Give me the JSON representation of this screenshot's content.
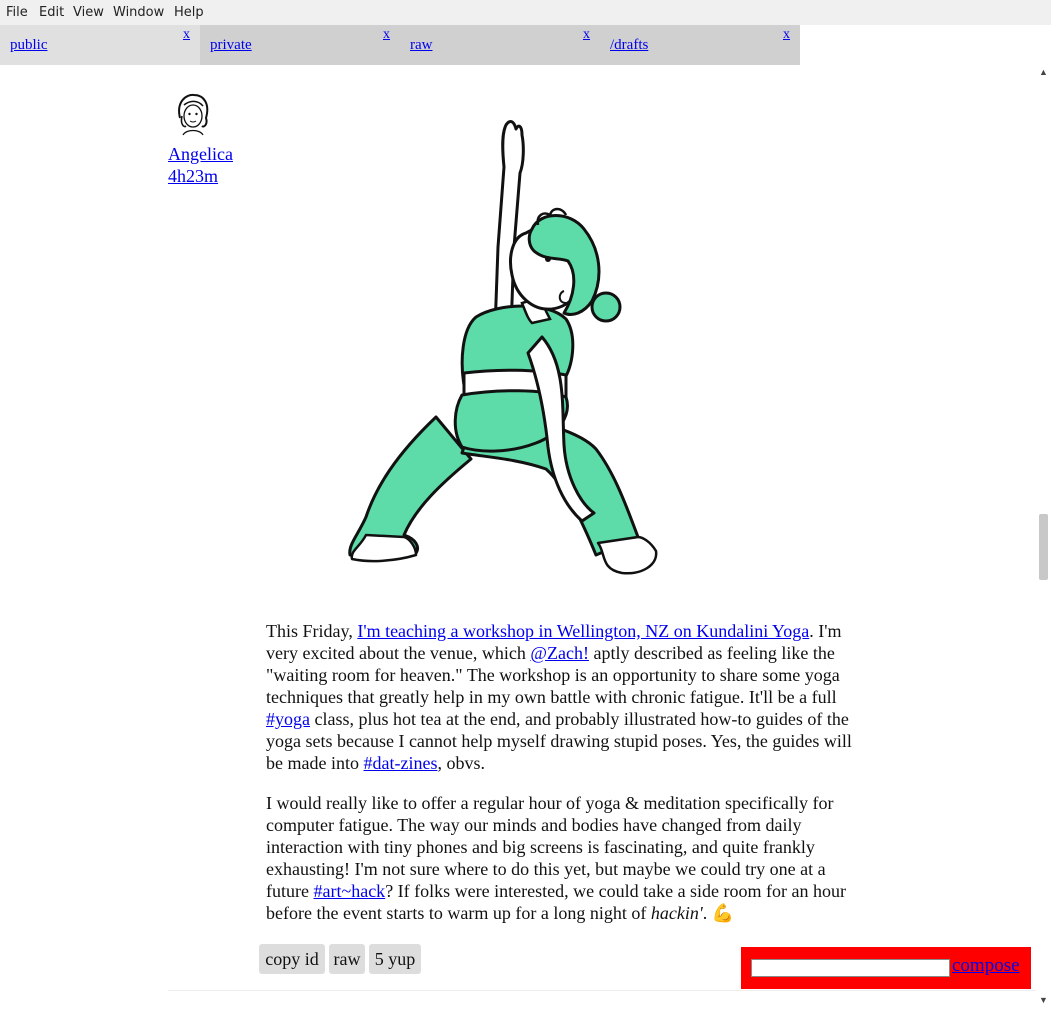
{
  "menu": [
    "File",
    "Edit",
    "View",
    "Window",
    "Help"
  ],
  "tabs": [
    {
      "label": "public",
      "close": "x",
      "bg": "#e0e0e0"
    },
    {
      "label": "private",
      "close": "x",
      "bg": "#d0d0d0"
    },
    {
      "label": "raw",
      "close": "x",
      "bg": "#d0d0d0"
    },
    {
      "label": "/drafts",
      "close": "x",
      "bg": "#d0d0d0"
    }
  ],
  "post": {
    "author": "Angelica",
    "time": "4h23m",
    "p1": {
      "t1": "This Friday, ",
      "link1": "I'm teaching a workshop in Wellington, NZ on Kundalini Yoga",
      "t2": ". I'm very excited about the venue, which ",
      "mention": "@Zach!",
      "t3": " aptly described as feeling like the \"waiting room for heaven.\" The workshop is an opportunity to share some yoga techniques that greatly help in my own battle with chronic fatigue. It'll be a full ",
      "tag1": "#yoga",
      "t4": " class, plus hot tea at the end, and probably illustrated how-to guides of the yoga sets because I cannot help myself drawing stupid poses. Yes, the guides will be made into ",
      "tag2": "#dat-zines",
      "t5": ", obvs."
    },
    "p2": {
      "t1": "I would really like to offer a regular hour of yoga & meditation specifically for computer fatigue. The way our minds and bodies have changed from daily interaction with tiny phones and big screens is fascinating, and quite frankly exhausting! I'm not sure where to do this yet, but maybe we could try one at a future ",
      "tag": "#art~hack",
      "t2": "? If folks were interested, we could take a side room for an hour before the event starts to warm up for a long night of ",
      "em": "hackin'",
      "t3": ". ",
      "emoji": "💪"
    },
    "actions": {
      "copy_id": "copy id",
      "raw": "raw",
      "yup": "5 yup"
    }
  },
  "compose": {
    "label": "compose",
    "input_value": ""
  },
  "colors": {
    "figure_green": "#5ddba9",
    "compose_bg": "#ff0000",
    "link": "#0000ee"
  }
}
